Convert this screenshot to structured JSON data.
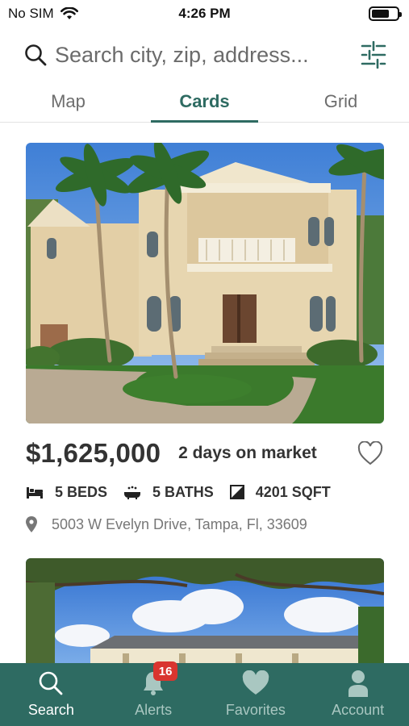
{
  "status_bar": {
    "carrier": "No SIM",
    "time": "4:26 PM",
    "battery_level": 0.7
  },
  "search": {
    "placeholder": "Search city, zip, address..."
  },
  "tabs": [
    {
      "label": "Map",
      "active": false
    },
    {
      "label": "Cards",
      "active": true
    },
    {
      "label": "Grid",
      "active": false
    }
  ],
  "listings": [
    {
      "price": "$1,625,000",
      "days_on_market": "2 days on market",
      "beds": "5 BEDS",
      "baths": "5 BATHS",
      "sqft": "4201 SQFT",
      "address": "5003 W Evelyn Drive, Tampa, Fl, 33609",
      "favorited": false
    }
  ],
  "nav": {
    "items": [
      {
        "label": "Search",
        "icon": "search-icon",
        "active": true
      },
      {
        "label": "Alerts",
        "icon": "bell-icon",
        "badge": "16",
        "active": false
      },
      {
        "label": "Favorites",
        "icon": "heart-icon",
        "active": false
      },
      {
        "label": "Account",
        "icon": "person-icon",
        "active": false
      }
    ]
  },
  "colors": {
    "brand": "#2e6b62",
    "badge": "#d9352f",
    "nav_inactive": "#a9c7c1"
  }
}
